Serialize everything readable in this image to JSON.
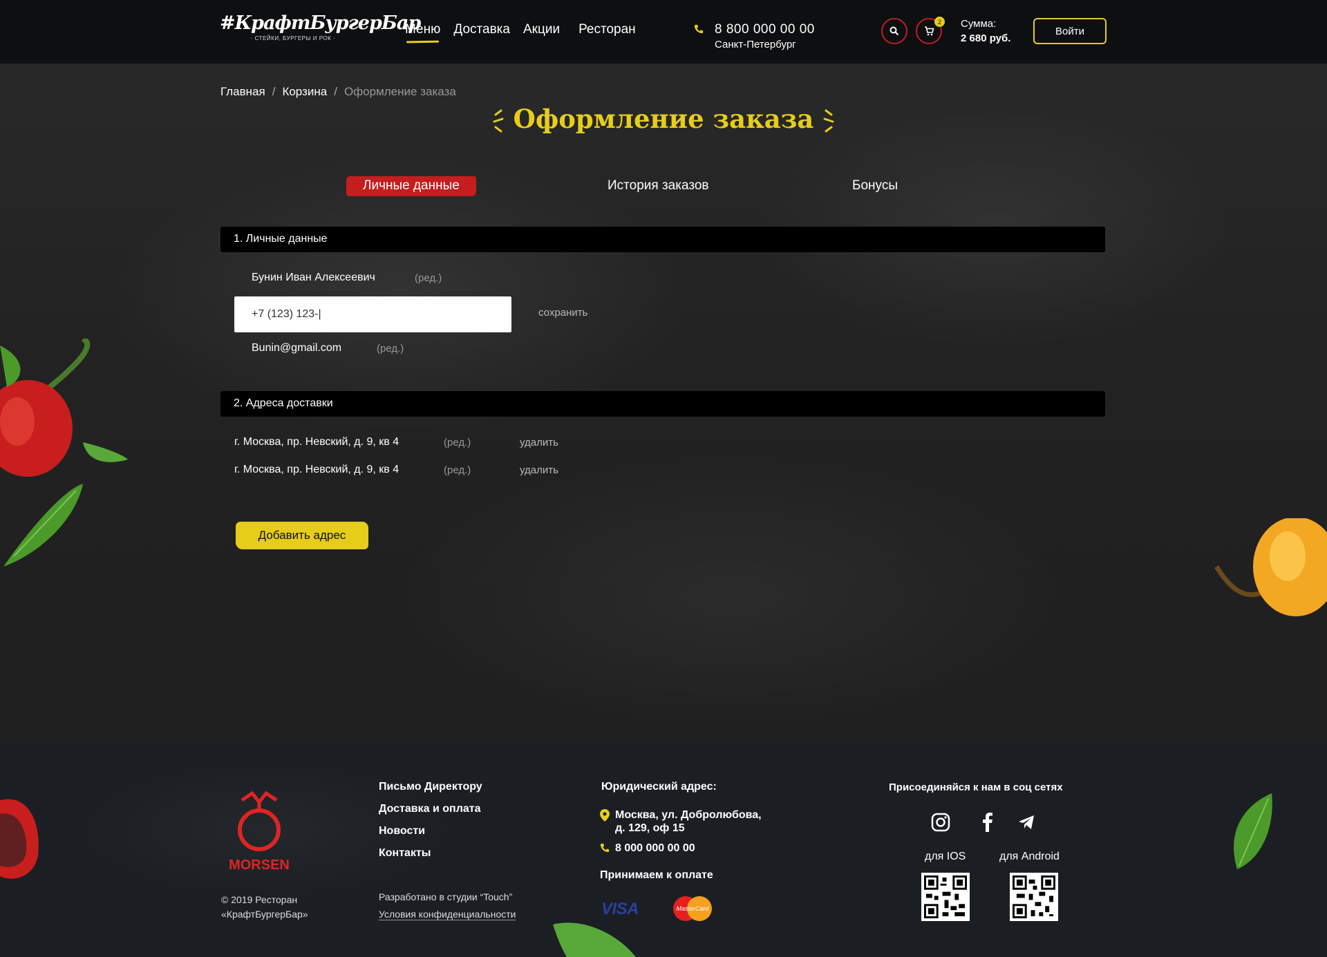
{
  "header": {
    "logo_text": "#КрафтБургерБар",
    "logo_tagline": "· СТЕЙКИ, БУРГЕРЫ И РОК ·",
    "nav": [
      {
        "label": "Меню",
        "active": true
      },
      {
        "label": "Доставка",
        "active": false
      },
      {
        "label": "Акции",
        "active": false
      },
      {
        "label": "Ресторан",
        "active": false
      }
    ],
    "phone": "8 800 000 00 00",
    "city": "Санкт-Петербург",
    "cart_count": "2",
    "sum_label": "Сумма:",
    "sum_value": "2 680 руб.",
    "login_label": "Войти",
    "icons": {
      "search": "search-icon",
      "cart": "cart-icon",
      "phone": "phone-icon"
    }
  },
  "breadcrumb": {
    "items": [
      "Главная",
      "Корзина",
      "Оформление заказа"
    ],
    "separator": "/"
  },
  "page_title": "Оформление заказа",
  "tabs": [
    {
      "label": "Личные данные",
      "active": true
    },
    {
      "label": "История заказов",
      "active": false
    },
    {
      "label": "Бонусы",
      "active": false
    }
  ],
  "personal": {
    "section_title": "1. Личные данные",
    "name": "Бунин Иван Алексеевич",
    "edit_label": "(ред.)",
    "phone_value": "+7 (123) 123-|",
    "save_label": "сохранить",
    "email": "Bunin@gmail.com"
  },
  "addresses": {
    "section_title": "2. Адреса доставки",
    "items": [
      {
        "text": "г. Москва, пр. Невский, д. 9, кв 4",
        "edit": "(ред.)",
        "delete": "удалить"
      },
      {
        "text": "г. Москва, пр. Невский, д. 9, кв 4",
        "edit": "(ред.)",
        "delete": "удалить"
      }
    ],
    "add_button": "Добавить адрес"
  },
  "footer": {
    "brand": "MORSEN",
    "copyright_line1": "© 2019 Ресторан",
    "copyright_line2": "«КрафтБургерБар»",
    "links": [
      "Письмо Директору",
      "Доставка и оплата",
      "Новости",
      "Контакты"
    ],
    "developer": "Разработано в студии “Touch”",
    "privacy": "Условия конфиденциальности",
    "legal_title": "Юридический адрес:",
    "address_line1": "Москва, ул. Добролюбова,",
    "address_line2": "д. 129, оф 15",
    "phone": "8 000 000 00 00",
    "payment_title": "Принимаем к оплате",
    "payment_visa": "VISA",
    "payment_mc": "MasterCard",
    "social_title": "Присоединяйся к нам в соц сетях",
    "social": [
      "instagram-icon",
      "facebook-icon",
      "telegram-icon"
    ],
    "ios_label": "для IOS",
    "android_label": "для Android"
  },
  "colors": {
    "accent_yellow": "#e6cd1a",
    "accent_red": "#c41e1e",
    "header_bg": "#0e0f11",
    "section_bar": "#000000"
  }
}
